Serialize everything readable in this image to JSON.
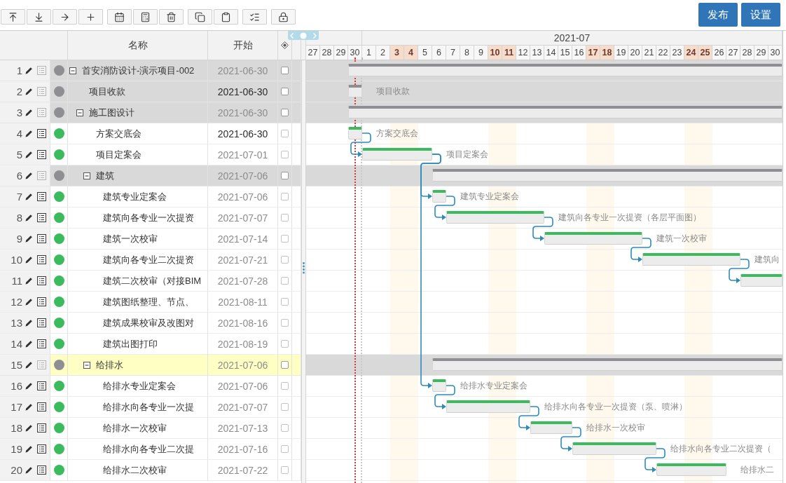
{
  "toolbar": {
    "groups": [
      {
        "buttons": [
          {
            "kind": "top"
          },
          {
            "kind": "bottom"
          },
          {
            "kind": "indent"
          },
          {
            "kind": "add"
          }
        ]
      },
      {
        "buttons": [
          {
            "kind": "calendar"
          },
          {
            "kind": "calculator"
          },
          {
            "kind": "delete"
          }
        ]
      },
      {
        "buttons": [
          {
            "kind": "copy"
          },
          {
            "kind": "paste"
          }
        ]
      },
      {
        "buttons": [
          {
            "kind": "checklist"
          }
        ]
      },
      {
        "buttons": [
          {
            "kind": "lock"
          }
        ]
      }
    ]
  },
  "actions": [
    "发布",
    "设置"
  ],
  "table": {
    "columns": [
      {
        "kind": "text",
        "label": "名称"
      },
      {
        "kind": "text",
        "label": "开始"
      },
      {
        "kind": "icon"
      }
    ]
  },
  "gantt": {
    "months": [
      {
        "days": [
          {
            "label": "27",
            "highlighted": false,
            "today": false,
            "marker": false
          },
          {
            "label": "28",
            "highlighted": false,
            "today": false,
            "marker": false
          },
          {
            "label": "29",
            "highlighted": false,
            "today": false,
            "marker": false
          },
          {
            "label": "30",
            "highlighted": false,
            "today": true,
            "marker": false
          }
        ]
      },
      {
        "label": "2021-07",
        "days": [
          {
            "label": "1",
            "highlighted": false,
            "today": false,
            "marker": true
          },
          {
            "label": "2",
            "highlighted": false,
            "today": false,
            "marker": false
          },
          {
            "label": "3",
            "highlighted": true,
            "today": false,
            "marker": false
          },
          {
            "label": "4",
            "highlighted": true,
            "today": false,
            "marker": false
          },
          {
            "label": "5",
            "highlighted": false,
            "today": false,
            "marker": false
          },
          {
            "label": "6",
            "highlighted": false,
            "today": false,
            "marker": false
          },
          {
            "label": "7",
            "highlighted": false,
            "today": false,
            "marker": false
          },
          {
            "label": "8",
            "highlighted": false,
            "today": false,
            "marker": false
          },
          {
            "label": "9",
            "highlighted": false,
            "today": false,
            "marker": false
          },
          {
            "label": "10",
            "highlighted": true,
            "today": false,
            "marker": false
          },
          {
            "label": "11",
            "highlighted": true,
            "today": false,
            "marker": false
          },
          {
            "label": "12",
            "highlighted": false,
            "today": false,
            "marker": false
          },
          {
            "label": "13",
            "highlighted": false,
            "today": false,
            "marker": false
          },
          {
            "label": "14",
            "highlighted": false,
            "today": false,
            "marker": false
          },
          {
            "label": "15",
            "highlighted": false,
            "today": false,
            "marker": false
          },
          {
            "label": "16",
            "highlighted": false,
            "today": false,
            "marker": false
          },
          {
            "label": "17",
            "highlighted": true,
            "today": false,
            "marker": false
          },
          {
            "label": "18",
            "highlighted": true,
            "today": false,
            "marker": false
          },
          {
            "label": "19",
            "highlighted": false,
            "today": false,
            "marker": false
          },
          {
            "label": "20",
            "highlighted": false,
            "today": false,
            "marker": false
          },
          {
            "label": "21",
            "highlighted": false,
            "today": false,
            "marker": false
          },
          {
            "label": "22",
            "highlighted": false,
            "today": false,
            "marker": false
          },
          {
            "label": "23",
            "highlighted": false,
            "today": false,
            "marker": false
          },
          {
            "label": "24",
            "highlighted": true,
            "today": false,
            "marker": false
          },
          {
            "label": "25",
            "highlighted": true,
            "today": false,
            "marker": false
          },
          {
            "label": "26",
            "highlighted": false,
            "today": false,
            "marker": false
          },
          {
            "label": "27",
            "highlighted": false,
            "today": false,
            "marker": false
          },
          {
            "label": "28",
            "highlighted": false,
            "today": false,
            "marker": false
          },
          {
            "label": "29",
            "highlighted": false,
            "today": false,
            "marker": false
          },
          {
            "label": "30",
            "highlighted": false,
            "today": false,
            "marker": false
          }
        ]
      }
    ]
  },
  "tasks": [
    {
      "num": "1",
      "name": "首安消防设计-演示项目-002",
      "start": "2021-06-30",
      "kind": "group",
      "expanded": true,
      "color": "#8e8e93",
      "shaded": true,
      "selected": false,
      "start_highlighted": false,
      "checked": false,
      "children": [
        {
          "num": "2",
          "name": "项目收款",
          "start": "2021-06-30",
          "kind": "task",
          "color": "#8e8e93",
          "shaded": true,
          "selected": false,
          "start_highlighted": true,
          "checked": false,
          "bar_label": "项目收款",
          "linked": false
        },
        {
          "num": "3",
          "name": "施工图设计",
          "start": "2021-06-30",
          "kind": "group",
          "expanded": true,
          "color": "#8e8e93",
          "shaded": true,
          "selected": false,
          "start_highlighted": false,
          "checked": false,
          "children": [
            {
              "num": "4",
              "name": "方案交底会",
              "start": "2021-06-30",
              "kind": "task",
              "color": "#3cba5e",
              "shaded": false,
              "selected": false,
              "start_highlighted": true,
              "checked": false,
              "bar_label": "方案交底会",
              "linked": false
            },
            {
              "num": "5",
              "name": "项目定案会",
              "start": "2021-07-01",
              "kind": "task",
              "color": "#3cba5e",
              "shaded": false,
              "selected": false,
              "start_highlighted": false,
              "checked": false,
              "bar_label": "项目定案会",
              "linked": true
            },
            {
              "num": "6",
              "name": "建筑",
              "start": "2021-07-06",
              "kind": "group",
              "expanded": true,
              "color": "#8e8e93",
              "shaded": true,
              "selected": false,
              "start_highlighted": false,
              "checked": false,
              "children": [
                {
                  "num": "7",
                  "name": "建筑专业定案会",
                  "start": "2021-07-06",
                  "kind": "task",
                  "color": "#3cba5e",
                  "shaded": false,
                  "selected": false,
                  "start_highlighted": false,
                  "checked": false,
                  "bar_label": "建筑专业定案会",
                  "linked": true
                },
                {
                  "num": "8",
                  "name": "建筑向各专业一次提资",
                  "start": "2021-07-07",
                  "kind": "task",
                  "color": "#3cba5e",
                  "shaded": false,
                  "selected": false,
                  "start_highlighted": false,
                  "checked": false,
                  "bar_label": "建筑向各专业一次提资（各层平面图）",
                  "linked": true
                },
                {
                  "num": "9",
                  "name": "建筑一次校审",
                  "start": "2021-07-14",
                  "kind": "task",
                  "color": "#3cba5e",
                  "shaded": false,
                  "selected": false,
                  "start_highlighted": false,
                  "checked": false,
                  "bar_label": "建筑一次校审",
                  "linked": true
                },
                {
                  "num": "10",
                  "name": "建筑向各专业二次提资",
                  "start": "2021-07-21",
                  "kind": "task",
                  "color": "#3cba5e",
                  "shaded": false,
                  "selected": false,
                  "start_highlighted": false,
                  "checked": false,
                  "bar_label": "建筑向",
                  "linked": true
                },
                {
                  "num": "11",
                  "name": "建筑二次校审（对接BIM",
                  "start": "2021-07-28",
                  "kind": "task",
                  "color": "#3cba5e",
                  "shaded": false,
                  "selected": false,
                  "start_highlighted": false,
                  "checked": false,
                  "linked": true
                },
                {
                  "num": "12",
                  "name": "建筑图纸整理、节点、",
                  "start": "2021-08-11",
                  "kind": "task",
                  "color": "#3cba5e",
                  "shaded": false,
                  "selected": false,
                  "start_highlighted": false,
                  "checked": false
                },
                {
                  "num": "13",
                  "name": "建筑成果校审及改图对",
                  "start": "2021-08-16",
                  "kind": "task",
                  "color": "#3cba5e",
                  "shaded": false,
                  "selected": false,
                  "start_highlighted": false,
                  "checked": false
                },
                {
                  "num": "14",
                  "name": "建筑出图打印",
                  "start": "2021-08-19",
                  "kind": "task",
                  "color": "#3cba5e",
                  "shaded": false,
                  "selected": false,
                  "start_highlighted": false,
                  "checked": false
                }
              ]
            },
            {
              "num": "15",
              "name": "给排水",
              "start": "2021-07-06",
              "kind": "group",
              "expanded": true,
              "color": "#8e8e93",
              "shaded": true,
              "selected": true,
              "start_highlighted": false,
              "checked": false,
              "children": [
                {
                  "num": "16",
                  "name": "给排水专业定案会",
                  "start": "2021-07-06",
                  "kind": "task",
                  "color": "#3cba5e",
                  "shaded": false,
                  "selected": false,
                  "start_highlighted": false,
                  "checked": false,
                  "bar_label": "给排水专业定案会",
                  "linked": true
                },
                {
                  "num": "17",
                  "name": "给排水向各专业一次提",
                  "start": "2021-07-07",
                  "kind": "task",
                  "color": "#3cba5e",
                  "shaded": false,
                  "selected": false,
                  "start_highlighted": false,
                  "checked": false,
                  "bar_label": "给排水向各专业一次提资（泵、喷淋）",
                  "linked": true
                },
                {
                  "num": "18",
                  "name": "给排水一次校审",
                  "start": "2021-07-13",
                  "kind": "task",
                  "color": "#3cba5e",
                  "shaded": false,
                  "selected": false,
                  "start_highlighted": false,
                  "checked": false,
                  "bar_label": "给排水一次校审",
                  "linked": true
                },
                {
                  "num": "19",
                  "name": "给排水向各专业二次提",
                  "start": "2021-07-16",
                  "kind": "task",
                  "color": "#3cba5e",
                  "shaded": false,
                  "selected": false,
                  "start_highlighted": false,
                  "checked": false,
                  "bar_label": "给排水向各专业二次提资（",
                  "linked": true
                },
                {
                  "num": "20",
                  "name": "给排水二次校审",
                  "start": "2021-07-22",
                  "kind": "task",
                  "color": "#3cba5e",
                  "shaded": false,
                  "selected": false,
                  "start_highlighted": false,
                  "checked": false,
                  "bar_label": "给排水二",
                  "linked": true
                }
              ]
            }
          ]
        }
      ]
    }
  ]
}
